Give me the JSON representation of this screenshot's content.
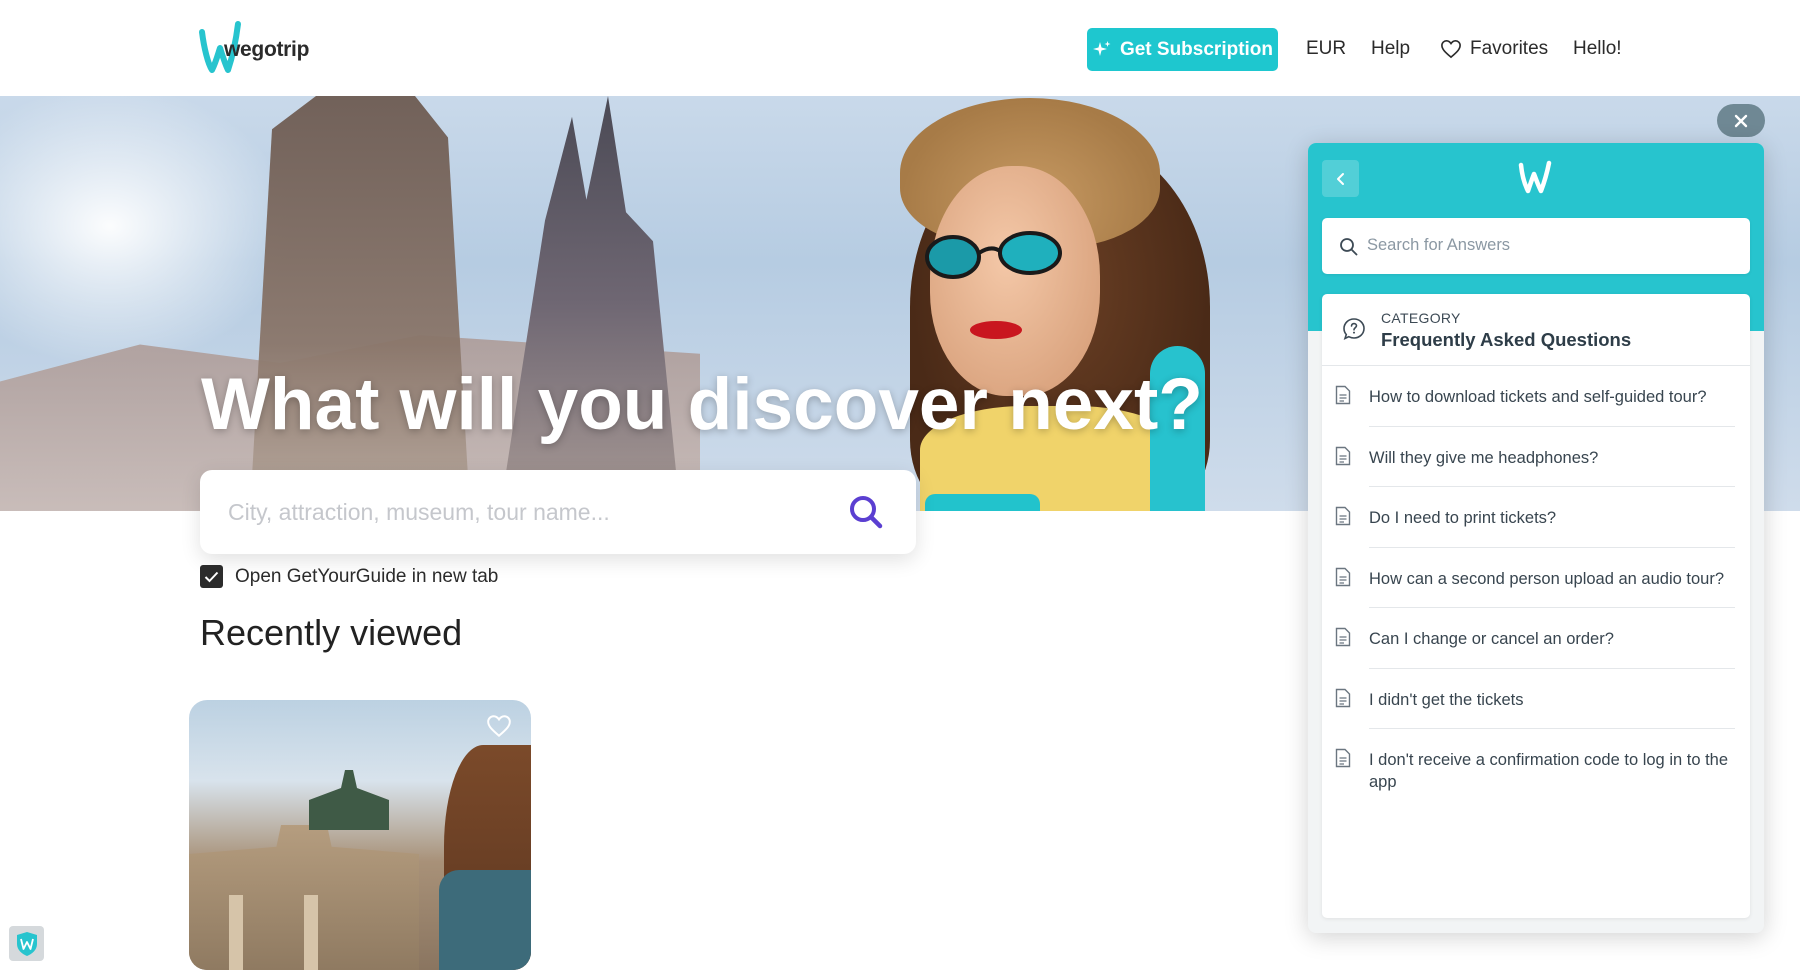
{
  "header": {
    "logo_text": "wegotrip",
    "subscription_label": "Get Subscription",
    "currency": "EUR",
    "help": "Help",
    "favorites": "Favorites",
    "greeting": "Hello!"
  },
  "hero": {
    "title": "What will you discover next?",
    "search_placeholder": "City, attraction, museum, tour name..."
  },
  "options": {
    "open_gyg_label": "Open GetYourGuide in new tab",
    "open_gyg_checked": true
  },
  "recent": {
    "title": "Recently viewed"
  },
  "help_widget": {
    "search_placeholder": "Search for Answers",
    "category_label": "CATEGORY",
    "category_title": "Frequently Asked Questions",
    "questions": [
      "How to download tickets and self-guided tour?",
      "Will they give me headphones?",
      "Do I need to print tickets?",
      "How can a second person upload an audio tour?",
      "Can I change or cancel an order?",
      "I didn't get the tickets",
      "I don't receive a confirmation code to log in to the app"
    ]
  },
  "colors": {
    "brand_teal": "#27c4ce",
    "search_icon": "#5b3fd1"
  }
}
